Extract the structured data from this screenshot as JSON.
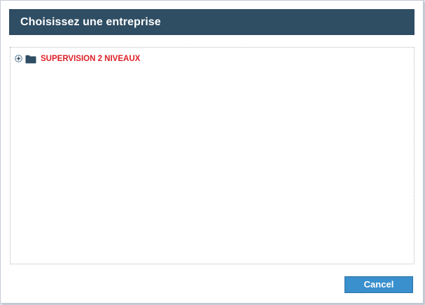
{
  "dialog": {
    "title": "Choisissez une entreprise"
  },
  "tree": {
    "nodes": [
      {
        "label": "SUPERVISION 2 NIVEAUX",
        "expand_icon": "plus-circle-icon",
        "icon": "folder-icon",
        "expanded": false
      }
    ]
  },
  "actions": {
    "cancel_label": "Cancel"
  },
  "colors": {
    "title_bar": "#2f4d63",
    "node_label": "#dd1f26",
    "folder": "#2f4d63",
    "button": "#3a8fcd"
  }
}
